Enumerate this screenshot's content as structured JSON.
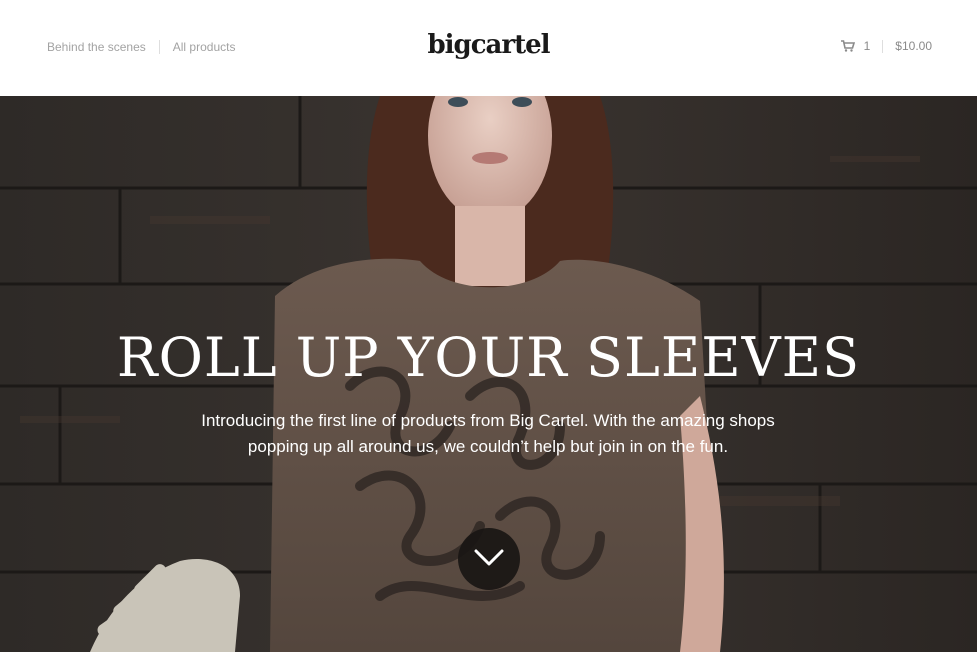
{
  "header": {
    "nav": [
      {
        "label": "Behind the scenes"
      },
      {
        "label": "All products"
      }
    ],
    "logo": "bigcartel",
    "cart": {
      "count": "1",
      "total": "$10.00",
      "icon": "cart-icon"
    }
  },
  "hero": {
    "title": "ROLL UP YOUR SLEEVES",
    "description": "Introducing the first line of products from Big Cartel. With the amazing shops popping up all around us, we couldn’t help but join in on the fun.",
    "scroll_icon": "chevron-down-icon"
  },
  "colors": {
    "nav_text": "#a3a3a3",
    "logo": "#1a1a1a",
    "hero_text": "#ffffff",
    "scroll_button": "#191614"
  }
}
